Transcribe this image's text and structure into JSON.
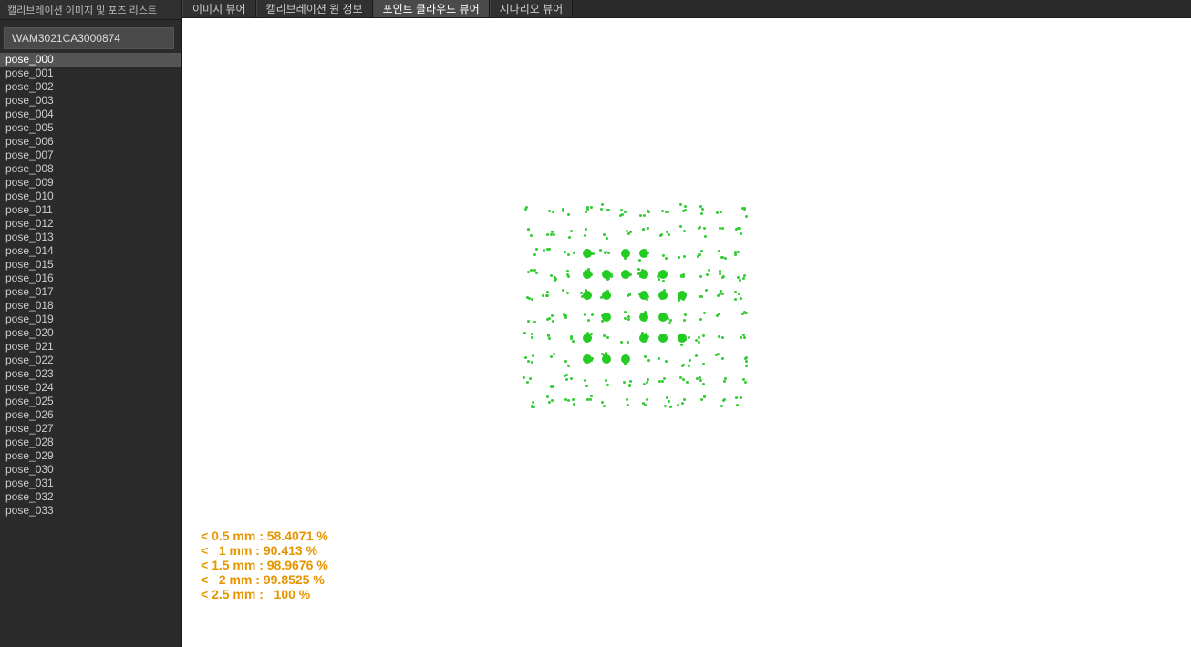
{
  "sidebar": {
    "title": "캘리브레이션 이미지 및 포즈 리스트",
    "device_id": "WAM3021CA3000874",
    "selected_pose_index": 0,
    "poses": [
      "pose_000",
      "pose_001",
      "pose_002",
      "pose_003",
      "pose_004",
      "pose_005",
      "pose_006",
      "pose_007",
      "pose_008",
      "pose_009",
      "pose_010",
      "pose_011",
      "pose_012",
      "pose_013",
      "pose_014",
      "pose_015",
      "pose_016",
      "pose_017",
      "pose_018",
      "pose_019",
      "pose_020",
      "pose_021",
      "pose_022",
      "pose_023",
      "pose_024",
      "pose_025",
      "pose_026",
      "pose_027",
      "pose_028",
      "pose_029",
      "pose_030",
      "pose_031",
      "pose_032",
      "pose_033"
    ]
  },
  "tabs": {
    "items": [
      {
        "label": "이미지 뷰어"
      },
      {
        "label": "캘리브레이션 원 정보"
      },
      {
        "label": "포인트 클라우드 뷰어"
      },
      {
        "label": "시나리오 뷰어"
      }
    ],
    "active_index": 2
  },
  "stats": {
    "lines": [
      "< 0.5 mm : 58.4071 %",
      "<   1 mm : 90.413 %",
      "< 1.5 mm : 98.9676 %",
      "<   2 mm : 99.8525 %",
      "< 2.5 mm :   100 %"
    ],
    "thresholds_mm": [
      0.5,
      1.0,
      1.5,
      2.0,
      2.5
    ],
    "percentages": [
      58.4071,
      90.413,
      98.9676,
      99.8525,
      100
    ]
  },
  "colors": {
    "point": "#33cc33",
    "stats_text": "#e69500",
    "viewer_bg": "#ffffff",
    "chrome_bg": "#2b2b2b"
  }
}
